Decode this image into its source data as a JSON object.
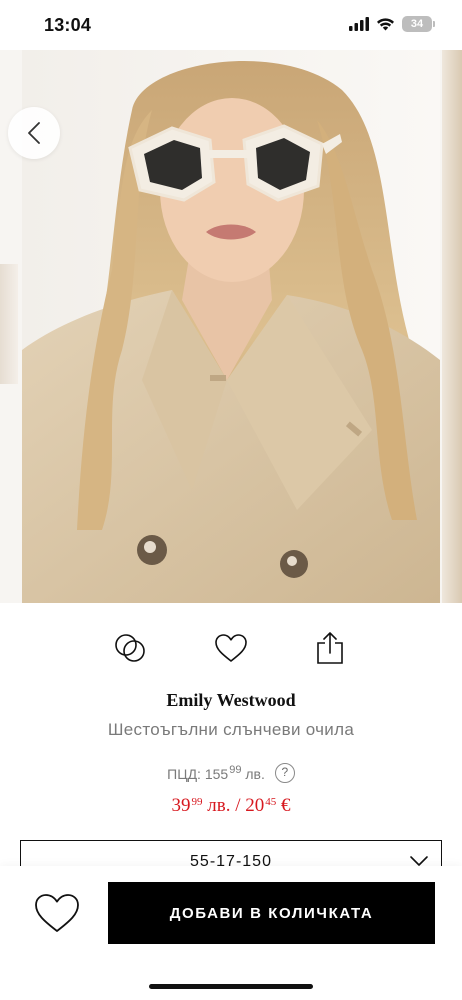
{
  "status_bar": {
    "time": "13:04",
    "battery": "34",
    "icons": [
      "cellular-signal-icon",
      "wifi-icon",
      "battery-icon"
    ]
  },
  "gallery": {
    "image_alt": "Жена с бежов тренчкот и бели шестоъгълни слънчеви очила",
    "slide_count": 6,
    "active_slide": 4,
    "icons": [
      "chevron-left-icon"
    ]
  },
  "actions": {
    "icons": [
      "compare-rings-icon",
      "heart-outline-icon",
      "share-icon"
    ]
  },
  "product": {
    "brand": "Emily Westwood",
    "name": "Шестоъгълни слънчеви очила",
    "rrp_label": "ПЦД:",
    "rrp_main": "155",
    "rrp_cents": "99",
    "rrp_currency": "лв.",
    "help_label": "?",
    "price_bgn_main": "39",
    "price_bgn_cents": "99",
    "price_bgn_currency": "лв.",
    "price_separator": "/",
    "price_eur_main": "20",
    "price_eur_cents": "45",
    "price_eur_currency": "€"
  },
  "size_select": {
    "value": "55-17-150"
  },
  "bottom_bar": {
    "add_to_cart_label": "ДОБАВИ В КОЛИЧКАТА"
  },
  "colors": {
    "price_red": "#d71920",
    "cta_black": "#000000",
    "muted_text": "#7a7a7a"
  }
}
